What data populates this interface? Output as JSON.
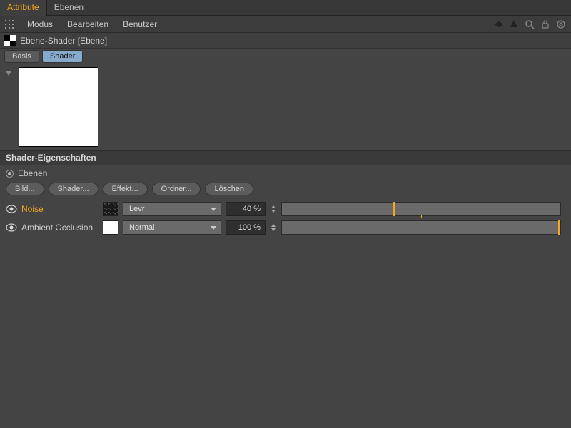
{
  "tabs": {
    "attribute": "Attribute",
    "ebenen": "Ebenen"
  },
  "menu": {
    "modus": "Modus",
    "bearbeiten": "Bearbeiten",
    "benutzer": "Benutzer"
  },
  "title": "Ebene-Shader [Ebene]",
  "subtabs": {
    "basis": "Basis",
    "shader": "Shader"
  },
  "section_header": "Shader-Eigenschaften",
  "radio_label": "Ebenen",
  "buttons": {
    "bild": "Bild...",
    "shader": "Shader...",
    "effekt": "Effekt...",
    "ordner": "Ordner...",
    "loeschen": "Löschen"
  },
  "layers": [
    {
      "name": "Noise",
      "blend": "Levr",
      "percent": "40 %",
      "slider_value": 40,
      "highlight": true,
      "swatch": "noise"
    },
    {
      "name": "Ambient Occlusion",
      "blend": "Normal",
      "percent": "100 %",
      "slider_value": 100,
      "highlight": false,
      "swatch": "white"
    }
  ]
}
